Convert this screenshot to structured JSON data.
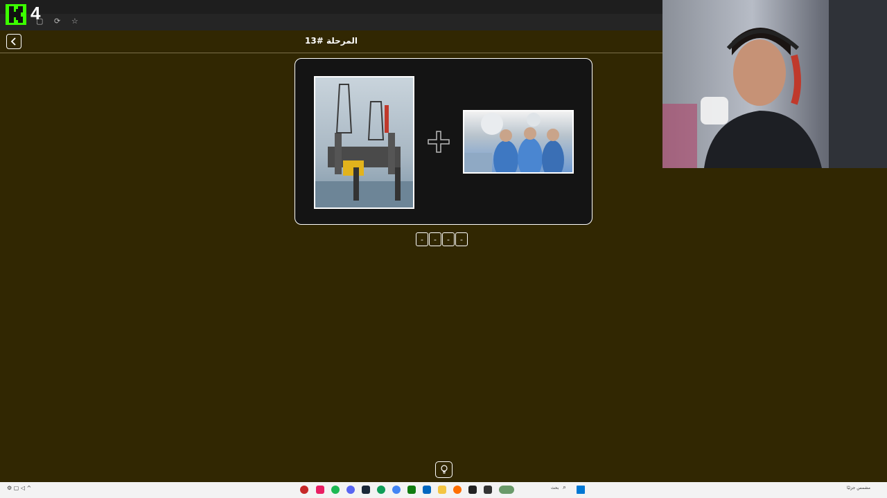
{
  "brand": {
    "logo_letter": "K",
    "logo_number": "4",
    "logo_color": "#3cff00"
  },
  "browser": {
    "icons": [
      "tab-icon",
      "refresh-icon",
      "star-icon"
    ]
  },
  "header": {
    "title": "المرحلة #13",
    "back_icon": "chevron-left-icon"
  },
  "puzzle": {
    "images": [
      {
        "name": "oil-rig-photo"
      },
      {
        "name": "surgeons-photo"
      }
    ],
    "operator": "+",
    "answer_slots": [
      "-",
      "-",
      "-",
      "-"
    ]
  },
  "hint": {
    "icon": "lightbulb-icon"
  },
  "webcam": {
    "name": "streamer-webcam"
  },
  "taskbar": {
    "search_placeholder": "بحث",
    "right_text": "مشمس جزئيًا",
    "colors": {
      "background": "#312702",
      "card": "#141414"
    }
  }
}
